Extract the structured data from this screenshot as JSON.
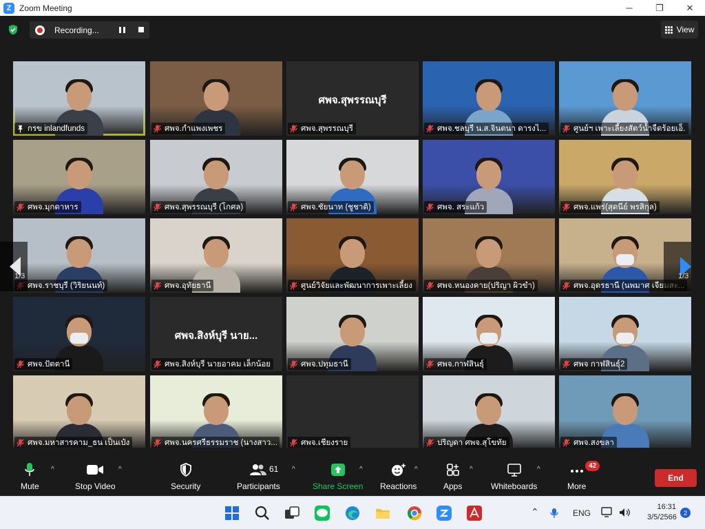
{
  "window": {
    "title": "Zoom Meeting",
    "logo": "Z",
    "minimize": "─",
    "restore": "❐",
    "close": "✕"
  },
  "recording": {
    "label": "Recording..."
  },
  "view": {
    "label": "View"
  },
  "pager": {
    "left": "1/3",
    "right": "1/3"
  },
  "tiles": [
    {
      "name": "กรข inlandfunds",
      "mic": "on",
      "bg": "#b9c3cc",
      "body": "#3b4048",
      "kind": "video"
    },
    {
      "name": "ศพจ.กำแพงเพชร",
      "mic": "off",
      "bg": "#7a5d44",
      "body": "#2c3540",
      "kind": "video"
    },
    {
      "name": "ศพจ.สุพรรณบุรี",
      "mic": "off",
      "big": "ศพจ.สุพรรณบุรี",
      "kind": "text"
    },
    {
      "name": "ศพจ.ชลบุรี  น.ส.จินตนา  ดารงไ...",
      "mic": "off",
      "bg": "#2a63b0",
      "body": "#7aa4c8",
      "kind": "video"
    },
    {
      "name": "ศูนย์ฯ เพาะเลี้ยงสัตว์น้ำจืดร้อยเอ็...",
      "mic": "off",
      "bg": "#5a99d2",
      "body": "#c9d3dc",
      "kind": "video"
    },
    {
      "name": "ศพจ.มุกดาหาร",
      "mic": "off",
      "bg": "#a9a08a",
      "body": "#2b3faa",
      "kind": "video"
    },
    {
      "name": "ศพจ.สุพรรณบุรี (โกศล)",
      "mic": "off",
      "bg": "#c8ccd0",
      "body": "#3a3f46",
      "kind": "video"
    },
    {
      "name": "ศพจ.ชัยนาท (ชูชาติ)",
      "mic": "off",
      "bg": "#d6d8da",
      "body": "#2f6cc1",
      "kind": "video"
    },
    {
      "name": "ศพจ. สระแก้ว",
      "mic": "off",
      "bg": "#3b4ea8",
      "body": "#a0a7b8",
      "kind": "video"
    },
    {
      "name": "ศพจ.แพร่(สุดนีย์ พรสิกุล)",
      "mic": "off",
      "bg": "#c9a868",
      "body": "#d6dfe6",
      "kind": "video"
    },
    {
      "name": "ศพจ.ราชบุรี (วิริยนนท์)",
      "mic": "off",
      "bg": "#b6bfc7",
      "body": "#2a3f63",
      "kind": "video"
    },
    {
      "name": "ศพจ.อุทัยธานี",
      "mic": "off",
      "bg": "#d9d3cb",
      "body": "#b7b1a8",
      "kind": "video"
    },
    {
      "name": "ศูนย์วิจัยและพัฒนาการเพาะเลี้ยง...",
      "mic": "off",
      "bg": "#8a5a33",
      "body": "#1c2228",
      "kind": "video"
    },
    {
      "name": "ศพจ.หนองคาย(ปริญา ผิวขำ)",
      "mic": "off",
      "bg": "#a07a54",
      "body": "#4a3f38",
      "kind": "video"
    },
    {
      "name": "ศพจ.อุดรธานี (นพมาศ เจียมสะ...",
      "mic": "off",
      "bg": "#c7b08c",
      "body": "#2d57a8",
      "kind": "video",
      "mask": true
    },
    {
      "name": "ศพจ.ปัตตานี",
      "mic": "off",
      "bg": "#1f2a3b",
      "body": "#1a1a1a",
      "kind": "video",
      "mask": true
    },
    {
      "name": "ศพจ.สิงห์บุรี นายอาคม  เล็กน้อย",
      "mic": "off",
      "big": "ศพจ.สิงห์บุรี นาย...",
      "kind": "text"
    },
    {
      "name": "ศพจ.ปทุมธานี",
      "mic": "off",
      "bg": "#cfd1cc",
      "body": "#2f3b5a",
      "kind": "video"
    },
    {
      "name": "ศพจ.กาฬสินธุ์",
      "mic": "off",
      "bg": "#dfe8ef",
      "body": "#1c1c1c",
      "kind": "video",
      "mask": true
    },
    {
      "name": "ศพจ กาฬสินธุ์ฺ2",
      "mic": "off",
      "bg": "#c6d8e6",
      "body": "#5b6f86",
      "kind": "video",
      "mask": true
    },
    {
      "name": "ศพจ.มหาสารคาม_ธน เป็นเป๋ง",
      "mic": "off",
      "bg": "#d8cbb4",
      "body": "#2b2b33",
      "kind": "video"
    },
    {
      "name": "ศพจ.นครศรีธรรมราช (นางสาว...",
      "mic": "off",
      "bg": "#e8edd9",
      "body": "#4a5c7a",
      "kind": "video"
    },
    {
      "name": "ศพจ.เชียงราย",
      "mic": "off",
      "kind": "empty"
    },
    {
      "name": "ปริญดา ศพจ.สุโขทัย",
      "mic": "off",
      "bg": "#ced6dc",
      "body": "#1c1c1c",
      "kind": "video"
    },
    {
      "name": "ศพจ.สงขลา",
      "mic": "off",
      "bg": "#6f9bb9",
      "body": "#4a7ab7",
      "kind": "video"
    }
  ],
  "toolbar": {
    "mute": "Mute",
    "stop_video": "Stop Video",
    "security": "Security",
    "participants": "Participants",
    "participant_count": "61",
    "share_screen": "Share Screen",
    "reactions": "Reactions",
    "apps": "Apps",
    "whiteboards": "Whiteboards",
    "more": "More",
    "more_badge": "42",
    "end": "End"
  },
  "colors": {
    "share_green": "#22c55e",
    "end_red": "#cc2b2b",
    "active_speaker": "#d4e31a"
  },
  "taskbar": {
    "icons": [
      "windows-start-icon",
      "search-icon",
      "task-view-icon",
      "line-icon",
      "edge-icon",
      "file-explorer-icon",
      "chrome-icon",
      "zoom-icon",
      "acrobat-icon"
    ],
    "language": "ENG",
    "time": "16:31",
    "date": "3/5/2566",
    "notification_count": "2"
  }
}
